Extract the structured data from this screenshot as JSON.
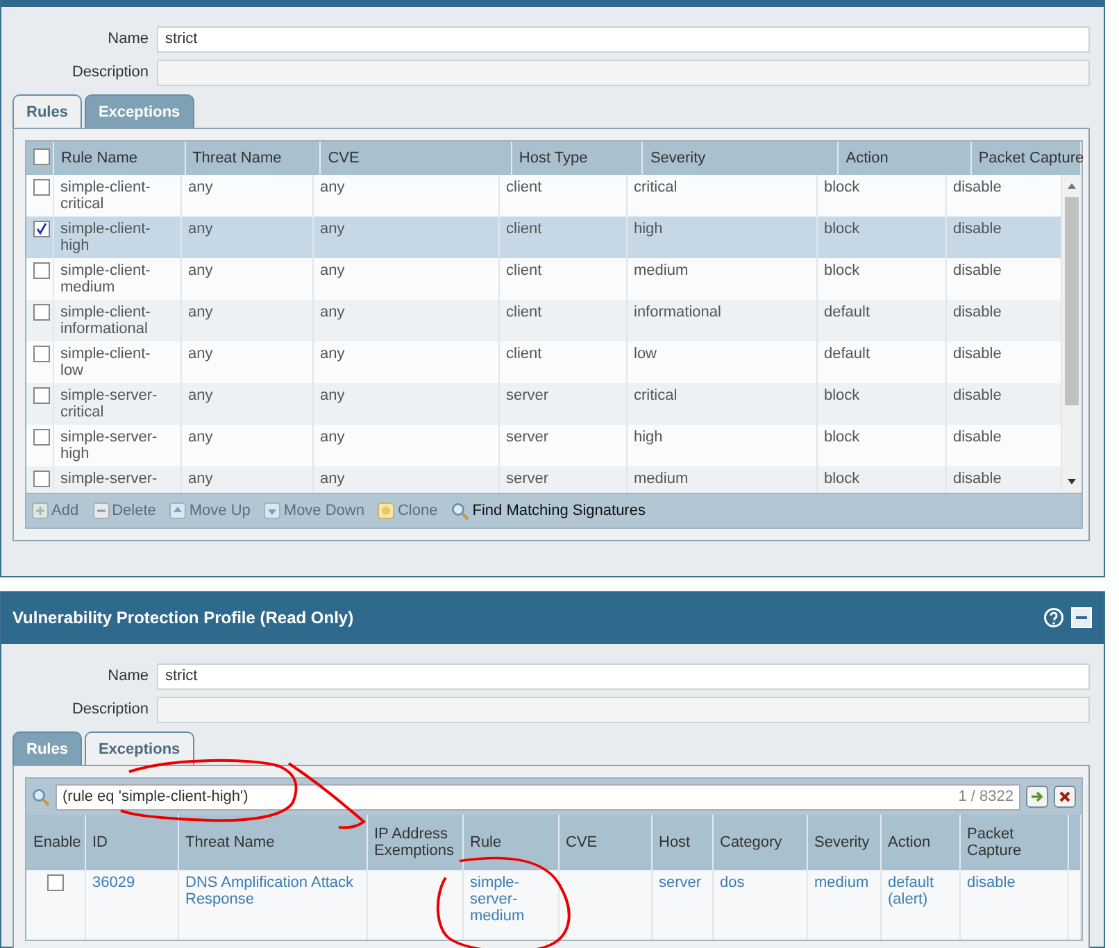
{
  "top_dialog": {
    "name_label": "Name",
    "name_value": "strict",
    "description_label": "Description",
    "tabs": [
      {
        "label": "Rules",
        "selected": true
      },
      {
        "label": "Exceptions",
        "selected": false
      }
    ],
    "rules_table": {
      "select_all_checked": false,
      "columns": [
        "Rule Name",
        "Threat Name",
        "CVE",
        "Host Type",
        "Severity",
        "Action",
        "Packet Capture"
      ],
      "rows": [
        {
          "checked": false,
          "selected": false,
          "cells": [
            "simple-client-critical",
            "any",
            "any",
            "client",
            "critical",
            "block",
            "disable"
          ]
        },
        {
          "checked": true,
          "selected": true,
          "cells": [
            "simple-client-high",
            "any",
            "any",
            "client",
            "high",
            "block",
            "disable"
          ]
        },
        {
          "checked": false,
          "selected": false,
          "cells": [
            "simple-client-medium",
            "any",
            "any",
            "client",
            "medium",
            "block",
            "disable"
          ]
        },
        {
          "checked": false,
          "selected": false,
          "cells": [
            "simple-client-informational",
            "any",
            "any",
            "client",
            "informational",
            "default",
            "disable"
          ]
        },
        {
          "checked": false,
          "selected": false,
          "cells": [
            "simple-client-low",
            "any",
            "any",
            "client",
            "low",
            "default",
            "disable"
          ]
        },
        {
          "checked": false,
          "selected": false,
          "cells": [
            "simple-server-critical",
            "any",
            "any",
            "server",
            "critical",
            "block",
            "disable"
          ]
        },
        {
          "checked": false,
          "selected": false,
          "cells": [
            "simple-server-high",
            "any",
            "any",
            "server",
            "high",
            "block",
            "disable"
          ]
        },
        {
          "checked": false,
          "selected": false,
          "cells": [
            "simple-server-",
            "any",
            "any",
            "server",
            "medium",
            "block",
            "disable"
          ]
        }
      ]
    },
    "toolbar": [
      {
        "kind": "add",
        "label": "Add",
        "disabled": true
      },
      {
        "kind": "delete",
        "label": "Delete",
        "disabled": true
      },
      {
        "kind": "up",
        "label": "Move Up",
        "disabled": true
      },
      {
        "kind": "down",
        "label": "Move Down",
        "disabled": true
      },
      {
        "kind": "clone",
        "label": "Clone",
        "disabled": true
      },
      {
        "kind": "find",
        "label": "Find Matching Signatures",
        "disabled": false
      }
    ]
  },
  "bottom_dialog": {
    "title": "Vulnerability Protection Profile (Read Only)",
    "name_label": "Name",
    "name_value": "strict",
    "description_label": "Description",
    "tabs": [
      {
        "label": "Rules",
        "selected": false
      },
      {
        "label": "Exceptions",
        "selected": true
      }
    ],
    "filter": {
      "value": "(rule eq 'simple-client-high')",
      "count": "1 / 8322"
    },
    "exceptions_table": {
      "columns": [
        "Enable",
        "ID",
        "Threat Name",
        "IP Address Exemptions",
        "Rule",
        "CVE",
        "Host",
        "Category",
        "Severity",
        "Action",
        "Packet Capture"
      ],
      "rows": [
        {
          "enabled": false,
          "cells": [
            "",
            "36029",
            "DNS Amplification Attack Response",
            "",
            "simple-server-medium",
            "",
            "server",
            "dos",
            "medium",
            "default (alert)",
            "disable"
          ]
        }
      ]
    }
  }
}
